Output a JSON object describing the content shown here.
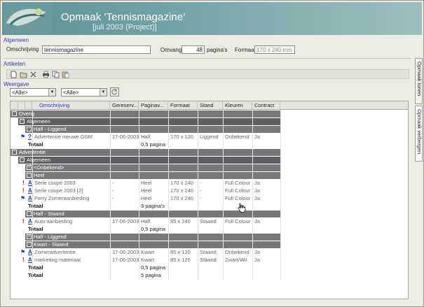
{
  "header": {
    "title": "Opmaak 'Tennismagazine'",
    "subtitle": "[juli 2003 (Project)]"
  },
  "algemeen": {
    "section_label": "Algemeen",
    "omschrijving_label": "Omschrijving",
    "omschrijving_value": "tennismagazine",
    "omvang_label": "Omvang",
    "omvang_value": "48",
    "omvang_unit": "pagina's",
    "formaat_label": "Formaat",
    "formaat_value": "170 x 240 mm"
  },
  "artikelen": {
    "section_label": "Artikelen",
    "toolbar_icons": [
      "new-document-icon",
      "open-folder-icon",
      "delete-icon",
      "print-icon",
      "copy-icon",
      "paste-icon"
    ]
  },
  "weergave": {
    "section_label": "Weergave",
    "filter1": "<Alle>",
    "filter2": "<Alle>"
  },
  "side_tabs": [
    "Opmaak tonen",
    "Opmaak verbergen"
  ],
  "grid": {
    "columns": [
      "Omschrijving",
      "Gereserv...",
      "Paginav...",
      "Formaat",
      "Stand",
      "Kleuren",
      "Contract"
    ],
    "rows": [
      {
        "type": "group",
        "level": 0,
        "label": "Overig",
        "toggle": "-"
      },
      {
        "type": "group",
        "level": 1,
        "label": "Algemeen",
        "toggle": "-"
      },
      {
        "type": "group",
        "level": 2,
        "label": "Half - Liggend",
        "toggle": "-"
      },
      {
        "type": "item",
        "flag": "flag",
        "icon": "?",
        "omschrijving": "Advertentie nieuwe GSM",
        "gereserveerd": "17-06-2003",
        "paginavullend": "Half",
        "formaat": "170 x 120",
        "stand": "Liggend",
        "kleuren": "Onbekend",
        "contract": "Ja"
      },
      {
        "type": "total",
        "label": "Totaal",
        "value": "0,5 pagina"
      },
      {
        "type": "group",
        "level": 0,
        "label": "Advertentie",
        "toggle": "-"
      },
      {
        "type": "group",
        "level": 1,
        "label": "Algemeen",
        "toggle": "-"
      },
      {
        "type": "group",
        "level": 2,
        "label": "<Onbekend>",
        "toggle": "+"
      },
      {
        "type": "group",
        "level": 2,
        "label": "Heel",
        "toggle": "-"
      },
      {
        "type": "item",
        "flag": "excl",
        "icon": "A",
        "omschrijving": "Serie coupe 2003",
        "gereserveerd": "-",
        "paginavullend": "Heel",
        "formaat": "170 x 240",
        "stand": "-",
        "kleuren": "Full Colour",
        "contract": "Ja"
      },
      {
        "type": "item",
        "flag": "excl",
        "icon": "A",
        "omschrijving": "Serie coupe 2003 [2]",
        "gereserveerd": "-",
        "paginavullend": "Heel",
        "formaat": "170 x 240",
        "stand": "-",
        "kleuren": "Full Colour",
        "contract": "Ja"
      },
      {
        "type": "item",
        "flag": "flag",
        "icon": "A",
        "omschrijving": "Perry Zomeraanbieding",
        "gereserveerd": "-",
        "paginavullend": "Heel",
        "formaat": "170 x 240",
        "stand": "-",
        "kleuren": "Full Colour",
        "contract": "Ja"
      },
      {
        "type": "total",
        "label": "Totaal",
        "value": "3 pagina's"
      },
      {
        "type": "group",
        "level": 2,
        "label": "Half - Staand",
        "toggle": "-"
      },
      {
        "type": "item",
        "flag": "excl",
        "icon": "A",
        "omschrijving": "Auto aanbieding",
        "gereserveerd": "17-06-2003",
        "paginavullend": "Half",
        "formaat": "85 x 240",
        "stand": "Staand",
        "kleuren": "Full Colour",
        "contract": "Ja"
      },
      {
        "type": "total",
        "label": "Totaal",
        "value": "0,5 pagina"
      },
      {
        "type": "group",
        "level": 2,
        "label": "Half - Liggend",
        "toggle": "+"
      },
      {
        "type": "group",
        "level": 2,
        "label": "Kwart - Staand",
        "toggle": "-"
      },
      {
        "type": "item",
        "flag": "flag",
        "icon": "A",
        "omschrijving": "Zomeradvertentie",
        "gereserveerd": "17-06-2003",
        "paginavullend": "Kwart",
        "formaat": "85 x 120",
        "stand": "Staand",
        "kleuren": "Onbekend",
        "contract": "Ja"
      },
      {
        "type": "item",
        "flag": "excl",
        "icon": "A",
        "omschrijving": "marketing materiaal",
        "gereserveerd": "17-06-2003",
        "paginavullend": "Kwart",
        "formaat": "85 x 120",
        "stand": "Staand",
        "kleuren": "Zwart/Wit",
        "contract": "Ja"
      },
      {
        "type": "total",
        "label": "Totaal",
        "value": "0,5 pagina"
      },
      {
        "type": "total",
        "label": "Totaal",
        "value": "5 pagina"
      }
    ]
  }
}
